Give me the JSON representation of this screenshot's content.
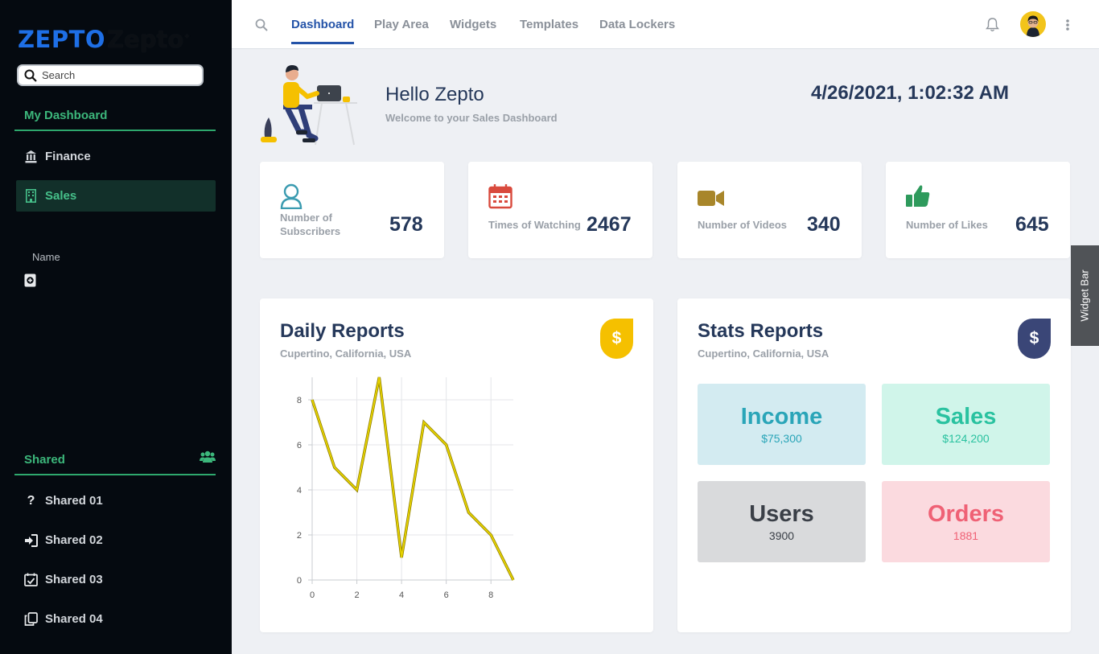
{
  "sidebar": {
    "logo": "ZEPTO",
    "logo_ghost": "Zepto",
    "search_placeholder": "Search",
    "my_dashboard": "My Dashboard",
    "items": [
      {
        "label": "Finance",
        "icon": "bank-icon"
      },
      {
        "label": "Sales",
        "icon": "building-icon",
        "active": true
      }
    ],
    "name_label": "Name",
    "shared_title": "Shared",
    "shared_items": [
      {
        "label": "Shared 01",
        "icon": "question-icon"
      },
      {
        "label": "Shared 02",
        "icon": "sign-in-icon"
      },
      {
        "label": "Shared 03",
        "icon": "calendar-check-icon"
      },
      {
        "label": "Shared 04",
        "icon": "copy-icon"
      }
    ]
  },
  "topbar": {
    "tabs": [
      "Dashboard",
      "Play Area",
      "Widgets",
      "Templates",
      "Data Lockers"
    ],
    "active_tab": "Dashboard"
  },
  "hero": {
    "greeting": "Hello Zepto",
    "subtitle": "Welcome to your Sales Dashboard",
    "datetime": "4/26/2021, 1:02:32 AM"
  },
  "stats": [
    {
      "label_line1": "Number of",
      "label_line2": "Subscribers",
      "value": "578",
      "icon": "user-icon",
      "color": "#3a9bb0"
    },
    {
      "label_line1": "Times of Watching",
      "label_line2": "",
      "value": "2467",
      "icon": "calendar-icon",
      "color": "#d94a3d"
    },
    {
      "label_line1": "Number of Videos",
      "label_line2": "",
      "value": "340",
      "icon": "video-camera-icon",
      "color": "#a8862a"
    },
    {
      "label_line1": "Number of Likes",
      "label_line2": "",
      "value": "645",
      "icon": "thumbs-up-icon",
      "color": "#2e9a5c"
    }
  ],
  "daily_reports": {
    "title": "Daily Reports",
    "subtitle": "Cupertino, California, USA",
    "badge": "$",
    "badge_color": "#f5c000"
  },
  "stats_reports": {
    "title": "Stats Reports",
    "subtitle": "Cupertino, California, USA",
    "badge": "$",
    "badge_color": "#3a4677",
    "tiles": [
      {
        "title": "Income",
        "value": "$75,300",
        "bg": "#d3ebf1",
        "color": "#2aa5b8"
      },
      {
        "title": "Sales",
        "value": "$124,200",
        "bg": "#d0f5ea",
        "color": "#2ac2a0"
      },
      {
        "title": "Users",
        "value": "3900",
        "bg": "#d9dadc",
        "color": "#3a3f47"
      },
      {
        "title": "Orders",
        "value": "1881",
        "bg": "#fbdadf",
        "color": "#ef6175"
      }
    ]
  },
  "chart_data": {
    "type": "line",
    "x": [
      0,
      1,
      2,
      3,
      4,
      5,
      6,
      7,
      8,
      9
    ],
    "series": [
      {
        "values": [
          8,
          5,
          4,
          9,
          1,
          7,
          6,
          3,
          2,
          0
        ]
      }
    ],
    "xticks": [
      "0",
      "2",
      "4",
      "6",
      "8"
    ],
    "yticks": [
      "0",
      "2",
      "4",
      "6",
      "8"
    ],
    "xlim": [
      0,
      9
    ],
    "ylim": [
      0,
      9
    ],
    "line_color": "#e6d200",
    "grid": true
  },
  "widget_bar": "Widget Bar"
}
